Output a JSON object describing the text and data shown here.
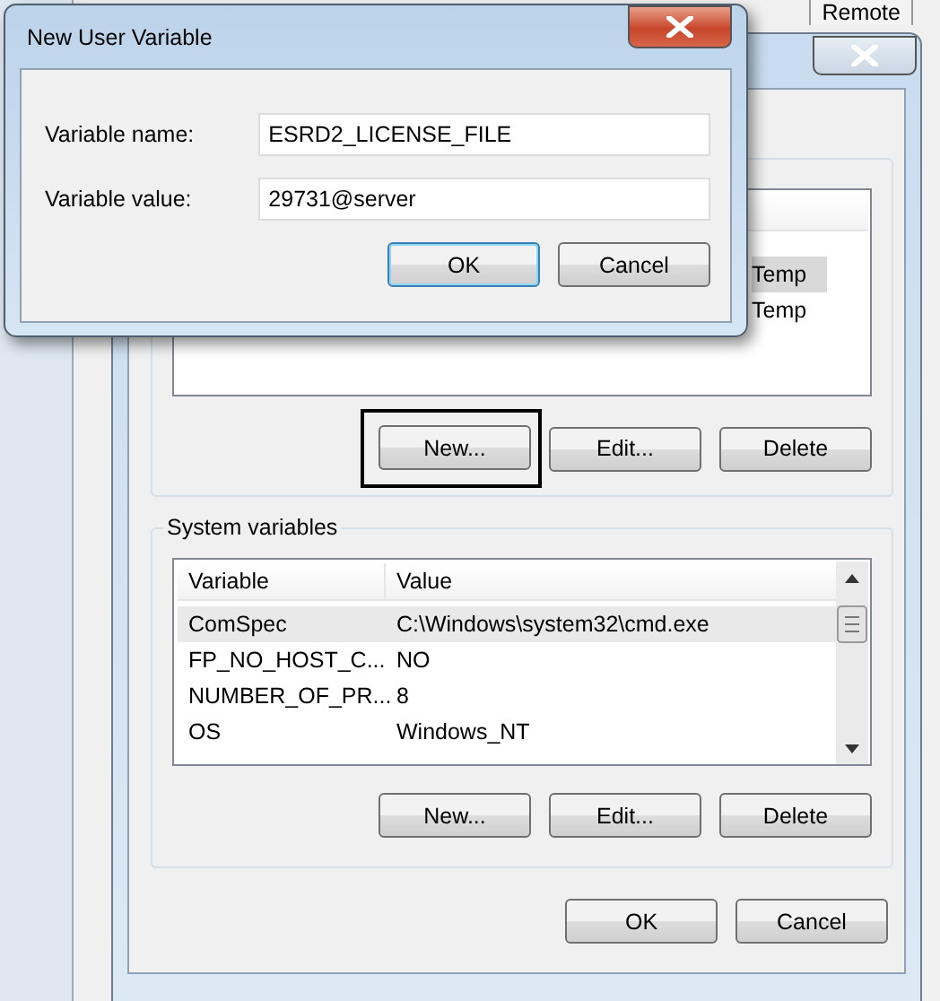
{
  "background_window": {
    "tabs": [
      {
        "label": "Remote",
        "selected": false
      }
    ]
  },
  "environment_dialog": {
    "user_variables": {
      "rows": [
        {
          "value": "Temp",
          "selected": true
        },
        {
          "value": "Temp",
          "selected": false
        }
      ],
      "buttons": [
        {
          "label": "New...",
          "focused": true
        },
        {
          "label": "Edit...",
          "focused": false
        },
        {
          "label": "Delete",
          "focused": false
        }
      ]
    },
    "system_variables": {
      "title": "System variables",
      "columns": [
        "Variable",
        "Value"
      ],
      "rows": [
        {
          "variable": "ComSpec",
          "value": "C:\\Windows\\system32\\cmd.exe",
          "selected": true
        },
        {
          "variable": "FP_NO_HOST_C...",
          "value": "NO",
          "selected": false
        },
        {
          "variable": "NUMBER_OF_PR...",
          "value": "8",
          "selected": false
        },
        {
          "variable": "OS",
          "value": "Windows_NT",
          "selected": false
        }
      ],
      "buttons": [
        {
          "label": "New...",
          "focused": false
        },
        {
          "label": "Edit...",
          "focused": false
        },
        {
          "label": "Delete",
          "focused": false
        }
      ]
    },
    "buttons": [
      "OK",
      "Cancel"
    ]
  },
  "new_variable_dialog": {
    "title": "New User Variable",
    "fields": [
      {
        "label": "Variable name:",
        "value": "ESRD2_LICENSE_FILE"
      },
      {
        "label": "Variable value:",
        "value": "29731@server"
      }
    ],
    "buttons": [
      {
        "label": "OK",
        "default": true
      },
      {
        "label": "Cancel",
        "default": false
      }
    ]
  }
}
